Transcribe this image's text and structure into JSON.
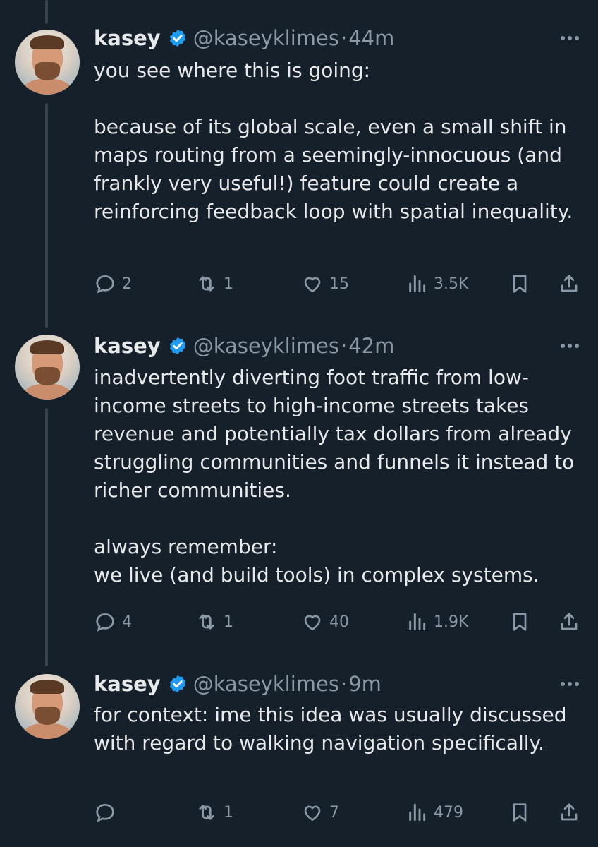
{
  "tweets": [
    {
      "name": "kasey",
      "handle": "@kaseyklimes",
      "dot": "·",
      "time": "44m",
      "text": "you see where this is going:\n\nbecause of its global scale, even a small shift in maps routing from a seemingly-innocuous (and frankly very useful!) feature could create a reinforcing feedback loop with spatial inequality.",
      "replies": "2",
      "reposts": "1",
      "likes": "15",
      "views": "3.5K"
    },
    {
      "name": "kasey",
      "handle": "@kaseyklimes",
      "dot": "·",
      "time": "42m",
      "text": "inadvertently diverting foot traffic from low-income streets to high-income streets takes revenue and potentially tax dollars from already struggling communities and funnels it instead to richer communities.\n\nalways remember:\nwe live (and build tools) in complex systems.",
      "replies": "4",
      "reposts": "1",
      "likes": "40",
      "views": "1.9K"
    },
    {
      "name": "kasey",
      "handle": "@kaseyklimes",
      "dot": "·",
      "time": "9m",
      "text": "for context: ime this idea was usually discussed with regard to walking navigation specifically.",
      "replies": "",
      "reposts": "1",
      "likes": "7",
      "views": "479"
    }
  ],
  "icons": {
    "verified": "verified-badge-icon",
    "reply": "reply-icon",
    "repost": "repost-icon",
    "like": "like-icon",
    "views": "views-icon",
    "bookmark": "bookmark-icon",
    "share": "share-icon",
    "more": "more-icon"
  },
  "colors": {
    "background": "#15202b",
    "text": "#e7e9ea",
    "muted": "#8b98a5",
    "verified": "#1d9bf0",
    "thread_line": "#38444d"
  }
}
